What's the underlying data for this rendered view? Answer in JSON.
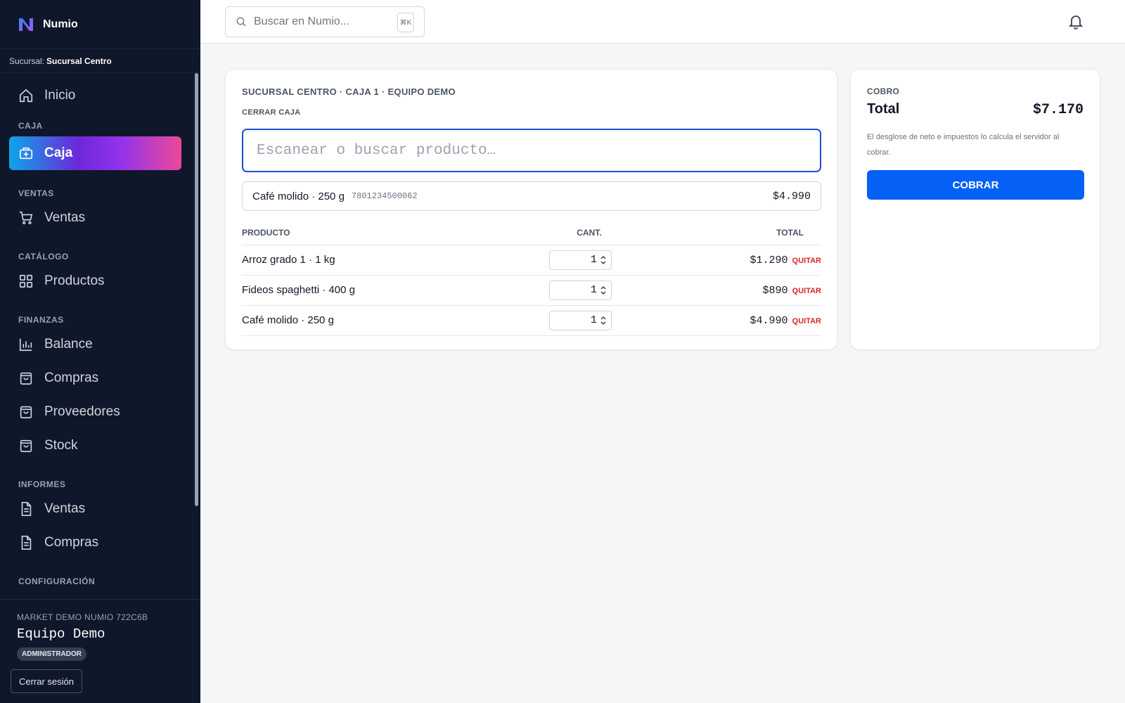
{
  "app": {
    "name": "Numio"
  },
  "branch": {
    "label": "Sucursal:",
    "name": "Sucursal Centro"
  },
  "nav": {
    "caja_section": "CAJA",
    "caja": "Caja",
    "ventas_section": "VENTAS",
    "ventas": "Ventas",
    "catalogo_section": "CATÁLOGO",
    "productos": "Productos",
    "finanzas_section": "FINANZAS",
    "balance": "Balance",
    "compras": "Compras",
    "proveedores": "Proveedores",
    "stock": "Stock",
    "informes_section": "INFORMES",
    "inf_ventas": "Ventas",
    "inf_compras": "Compras",
    "config_section": "CONFIGURACIÓN"
  },
  "footer": {
    "org": "MARKET DEMO NUMIO 722C6B",
    "user": "Equipo Demo",
    "role": "ADMINISTRADOR",
    "logout": "Cerrar sesión"
  },
  "search": {
    "placeholder": "Buscar en Numio...",
    "shortcut": "⌘K"
  },
  "pos": {
    "breadcrumb": "SUCURSAL CENTRO · CAJA 1 · EQUIPO DEMO",
    "close_register": "CERRAR CAJA",
    "scan_placeholder": "Escanear o buscar producto…",
    "suggestion": {
      "name": "Café molido · 250 g",
      "sku": "7801234500062",
      "price": "$4.990"
    },
    "columns": {
      "product": "PRODUCTO",
      "qty": "CANT.",
      "total": "TOTAL"
    },
    "remove_label": "QUITAR",
    "items": [
      {
        "name": "Arroz grado 1 · 1 kg",
        "qty": "1",
        "total": "$1.290"
      },
      {
        "name": "Fideos spaghetti · 400 g",
        "qty": "1",
        "total": "$890"
      },
      {
        "name": "Café molido · 250 g",
        "qty": "1",
        "total": "$4.990"
      }
    ]
  },
  "checkout": {
    "label": "COBRO",
    "total_label": "Total",
    "total_value": "$7.170",
    "note": "El desglose de neto e impuestos lo calcula el servidor al cobrar.",
    "pay_button": "COBRAR"
  },
  "colors": {
    "accent": "#0561f5",
    "sidebar": "#0f172a",
    "danger": "#dc2626"
  }
}
